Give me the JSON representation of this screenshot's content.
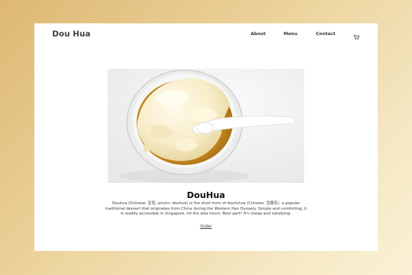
{
  "header": {
    "brand": "Dou Hua",
    "nav": {
      "about": "About",
      "menu": "Menu",
      "contact": "Contact"
    },
    "cart_icon": "shopping-cart-icon"
  },
  "hero": {
    "image_subject": "bowl-of-douhua-with-spoon"
  },
  "content": {
    "title": "DouHua",
    "description": "Douhua (Chinese: 豆花; pinyin: dòuhuā) is the short form of doufuhua (Chinese: 豆腐花), a popular traditional dessert that originates from China during the Western Han Dynasty. Simple and comforting, it is readily accessible in Singapore, till the wee hours. Best part? It's cheap and satisfying.",
    "order_link": "Order"
  },
  "colors": {
    "background_start": "#ddb873",
    "background_end": "#fbf2d6",
    "page": "#ffffff",
    "text": "#333333"
  }
}
